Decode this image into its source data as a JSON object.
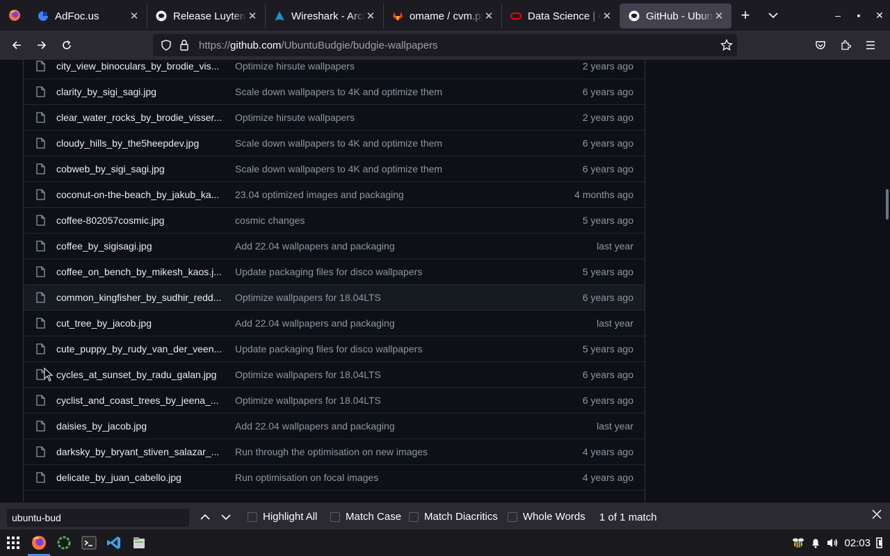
{
  "browser": {
    "tabs": [
      {
        "title": "AdFoc.us",
        "icon": "adfocus-favicon"
      },
      {
        "title": "Release LuytenX | ",
        "icon": "github-favicon"
      },
      {
        "title": "Wireshark - ArchW",
        "icon": "arch-favicon"
      },
      {
        "title": "omame / cvm.py",
        "icon": "gitlab-favicon"
      },
      {
        "title": "Data Science | Ora",
        "icon": "oracle-favicon"
      },
      {
        "title": "GitHub - UbuntuB",
        "icon": "github-favicon",
        "active": true
      }
    ],
    "url_prefix": "https://",
    "url_domain": "github.com",
    "url_path": "/UbuntuBudgie/budgie-wallpapers"
  },
  "files": [
    {
      "name": "city_view_binoculars_by_brodie_vis...",
      "message": "Optimize hirsute wallpapers",
      "age": "2 years ago"
    },
    {
      "name": "clarity_by_sigi_sagi.jpg",
      "message": "Scale down wallpapers to 4K and optimize them",
      "age": "6 years ago"
    },
    {
      "name": "clear_water_rocks_by_brodie_visser...",
      "message": "Optimize hirsute wallpapers",
      "age": "2 years ago"
    },
    {
      "name": "cloudy_hills_by_the5heepdev.jpg",
      "message": "Scale down wallpapers to 4K and optimize them",
      "age": "6 years ago"
    },
    {
      "name": "cobweb_by_sigi_sagi.jpg",
      "message": "Scale down wallpapers to 4K and optimize them",
      "age": "6 years ago"
    },
    {
      "name": "coconut-on-the-beach_by_jakub_ka...",
      "message": "23.04 optimized images and packaging",
      "age": "4 months ago"
    },
    {
      "name": "coffee-802057cosmic.jpg",
      "message": "cosmic changes",
      "age": "5 years ago"
    },
    {
      "name": "coffee_by_sigisagi.jpg",
      "message": "Add 22.04 wallpapers and packaging",
      "age": "last year"
    },
    {
      "name": "coffee_on_bench_by_mikesh_kaos.j...",
      "message": "Update packaging files for disco wallpapers",
      "age": "5 years ago"
    },
    {
      "name": "common_kingfisher_by_sudhir_redd...",
      "message": "Optimize wallpapers for 18.04LTS",
      "age": "6 years ago"
    },
    {
      "name": "cut_tree_by_jacob.jpg",
      "message": "Add 22.04 wallpapers and packaging",
      "age": "last year"
    },
    {
      "name": "cute_puppy_by_rudy_van_der_veen...",
      "message": "Update packaging files for disco wallpapers",
      "age": "5 years ago"
    },
    {
      "name": "cycles_at_sunset_by_radu_galan.jpg",
      "message": "Optimize wallpapers for 18.04LTS",
      "age": "6 years ago"
    },
    {
      "name": "cyclist_and_coast_trees_by_jeena_...",
      "message": "Optimize wallpapers for 18.04LTS",
      "age": "6 years ago"
    },
    {
      "name": "daisies_by_jacob.jpg",
      "message": "Add 22.04 wallpapers and packaging",
      "age": "last year"
    },
    {
      "name": "darksky_by_bryant_stiven_salazar_...",
      "message": "Run through the optimisation on new images",
      "age": "4 years ago"
    },
    {
      "name": "delicate_by_juan_cabello.jpg",
      "message": "Run optimisation on focal images",
      "age": "4 years ago"
    }
  ],
  "findbar": {
    "query": "ubuntu-bud",
    "highlight_all": "Highlight All",
    "match_case": "Match Case",
    "match_diacritics": "Match Diacritics",
    "whole_words": "Whole Words",
    "status": "1 of 1 match"
  },
  "taskbar": {
    "clock": "02:03"
  },
  "colors": {
    "page_bg": "#0d1117",
    "row_border": "#21262d",
    "file_name": "#e6edf3",
    "muted": "#8d96a0",
    "browser_chrome": "#2b2a33",
    "tabstrip": "#1c1b22"
  }
}
